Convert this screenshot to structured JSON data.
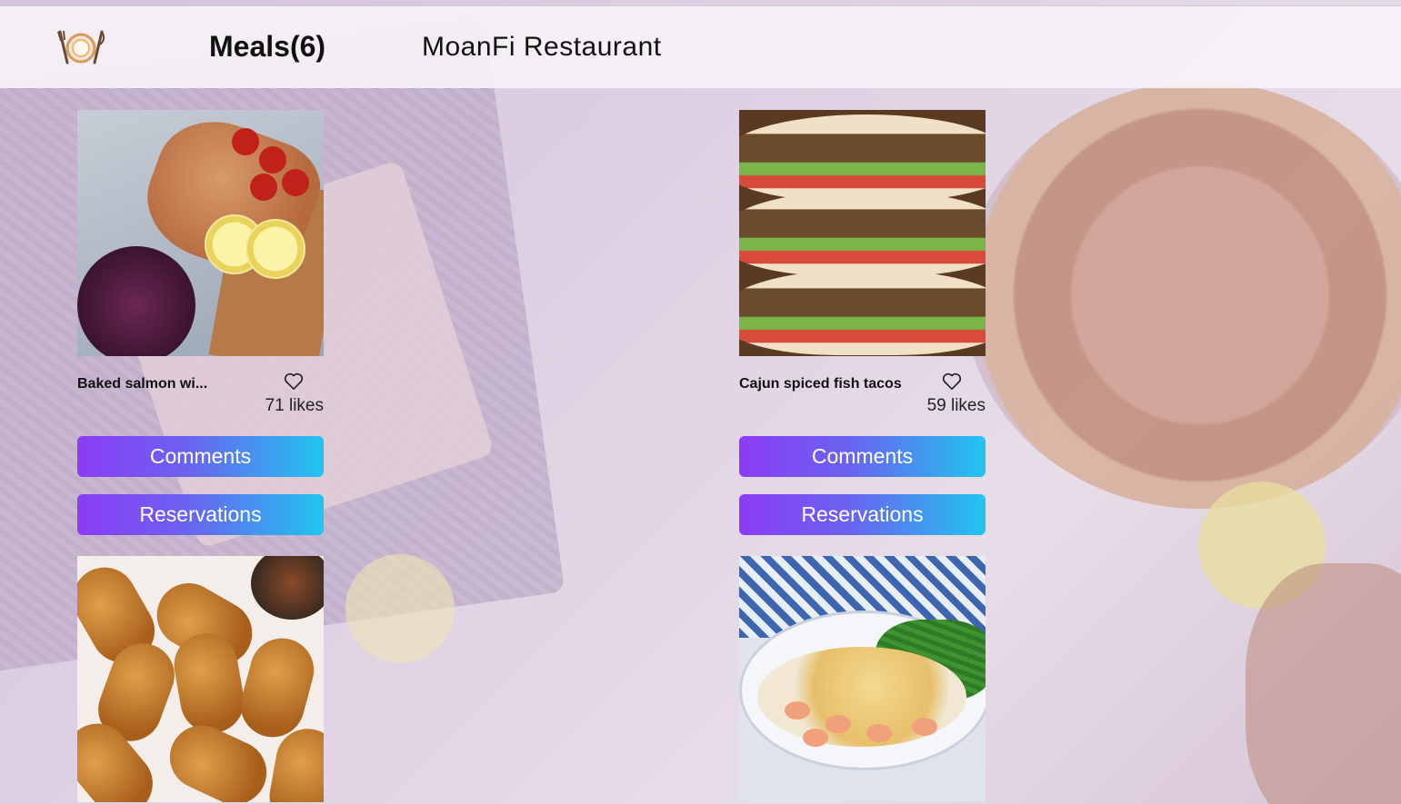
{
  "header": {
    "logo_icon": "plate-fork-knife-icon",
    "meals_count_label": "Meals(6)",
    "brand_title": "MoanFi Restaurant"
  },
  "meals": [
    {
      "name": "Baked salmon wi...",
      "likes_label": "71 likes",
      "likes": 71,
      "image": "baked-salmon-image",
      "comments_label": "Comments",
      "reservations_label": "Reservations"
    },
    {
      "name": "Cajun spiced fish tacos",
      "likes_label": "59 likes",
      "likes": 59,
      "image": "fish-tacos-image",
      "comments_label": "Comments",
      "reservations_label": "Reservations"
    },
    {
      "image": "croquettes-image"
    },
    {
      "image": "fish-pie-image"
    }
  ],
  "colors": {
    "button_gradient_start": "#8b3cf5",
    "button_gradient_end": "#20c5ef",
    "header_bg": "#f6f2f6",
    "page_bg": "#e0d3e4"
  }
}
